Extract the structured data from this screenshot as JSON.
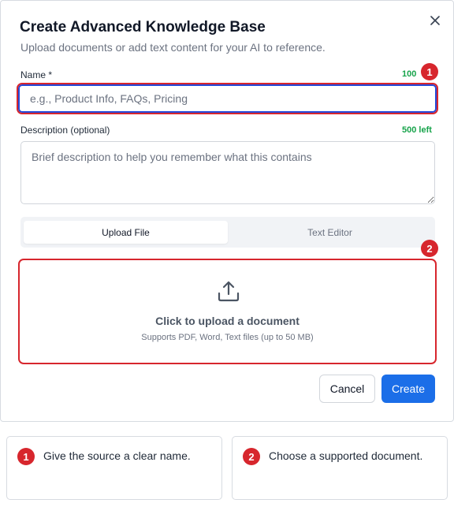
{
  "dialog": {
    "title": "Create Advanced Knowledge Base",
    "subtitle": "Upload documents or add text content for your AI to reference.",
    "close_icon": "close-icon"
  },
  "name_field": {
    "label": "Name *",
    "counter": "100",
    "placeholder": "e.g., Product Info, FAQs, Pricing",
    "value": ""
  },
  "description_field": {
    "label": "Description (optional)",
    "counter": "500 left",
    "placeholder": "Brief description to help you remember what this contains",
    "value": ""
  },
  "tabs": [
    {
      "label": "Upload File",
      "active": true
    },
    {
      "label": "Text Editor",
      "active": false
    }
  ],
  "upload": {
    "icon": "upload-icon",
    "title": "Click to upload a document",
    "subtitle": "Supports PDF, Word, Text files (up to 50 MB)"
  },
  "actions": {
    "cancel_label": "Cancel",
    "create_label": "Create"
  },
  "callouts": [
    {
      "number": "1",
      "text": "Give the source a clear name."
    },
    {
      "number": "2",
      "text": "Choose a supported document."
    }
  ],
  "colors": {
    "accent": "#1b6ee8",
    "highlight": "#d7262d",
    "counter": "#16a34a"
  }
}
